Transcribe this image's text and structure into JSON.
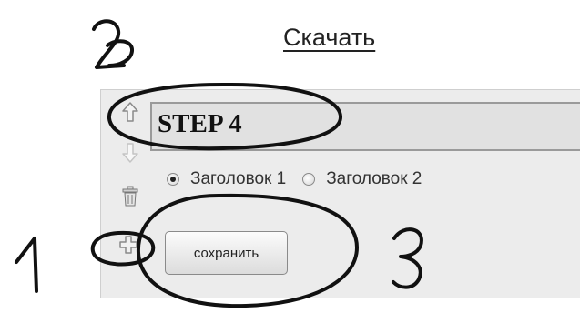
{
  "header": {
    "download_label": "Скачать"
  },
  "step": {
    "title": "STEP 4"
  },
  "radios": [
    {
      "label": "Заголовок 1",
      "checked": true
    },
    {
      "label": "Заголовок 2",
      "checked": false
    }
  ],
  "actions": {
    "save_label": "сохранить"
  },
  "side_icons": [
    "arrow-up-icon",
    "arrow-down-icon",
    "trash-icon",
    "add-icon"
  ],
  "annotations": {
    "markers": [
      "1",
      "2",
      "3"
    ]
  }
}
